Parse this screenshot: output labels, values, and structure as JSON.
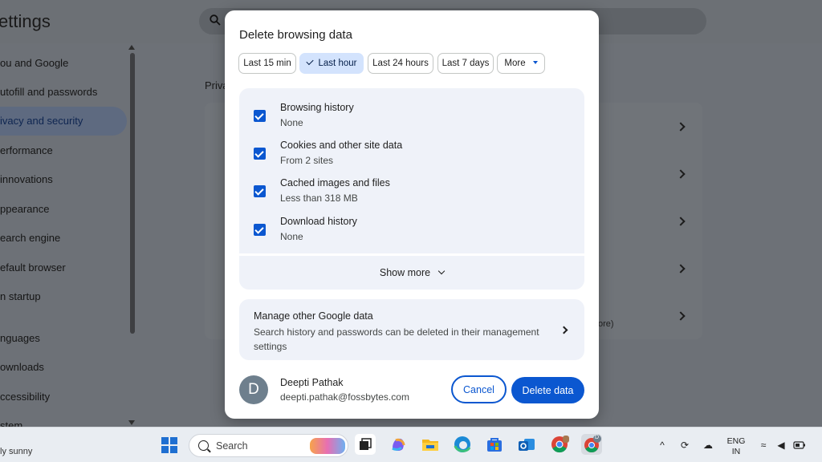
{
  "background": {
    "title": "ettings",
    "nav_items": [
      {
        "label": "ou and Google",
        "active": false
      },
      {
        "label": "utofill and passwords",
        "active": false
      },
      {
        "label": "ivacy and security",
        "active": true
      },
      {
        "label": "erformance",
        "active": false
      },
      {
        "label": " innovations",
        "active": false
      },
      {
        "label": "ppearance",
        "active": false
      },
      {
        "label": "earch engine",
        "active": false
      },
      {
        "label": "efault browser",
        "active": false
      },
      {
        "label": "n startup",
        "active": false
      },
      {
        "label": "nguages",
        "active": false
      },
      {
        "label": "ownloads",
        "active": false
      },
      {
        "label": "ccessibility",
        "active": false
      },
      {
        "label": "stem",
        "active": false
      }
    ],
    "section_label": "Priva",
    "card_fragment": "ore)"
  },
  "dialog": {
    "title": "Delete browsing data",
    "time_ranges": [
      {
        "label": "Last 15 min",
        "selected": false
      },
      {
        "label": "Last hour",
        "selected": true
      },
      {
        "label": "Last 24 hours",
        "selected": false
      },
      {
        "label": "Last 7 days",
        "selected": false
      },
      {
        "label": "More",
        "selected": false
      }
    ],
    "items": [
      {
        "title": "Browsing history",
        "subtitle": "None",
        "checked": true
      },
      {
        "title": "Cookies and other site data",
        "subtitle": "From 2 sites",
        "checked": true
      },
      {
        "title": "Cached images and files",
        "subtitle": "Less than 318 MB",
        "checked": true
      },
      {
        "title": "Download history",
        "subtitle": "None",
        "checked": true
      }
    ],
    "show_more": "Show more",
    "manage": {
      "title": "Manage other Google data",
      "subtitle": "Search history and passwords can be deleted in their management settings"
    },
    "account": {
      "initial": "D",
      "name": "Deepti Pathak",
      "email": "deepti.pathak@fossbytes.com"
    },
    "cancel_label": "Cancel",
    "delete_label": "Delete data",
    "accent_color": "#0b57d0"
  },
  "taskbar": {
    "weather": "ly sunny",
    "search_placeholder": "Search",
    "language_top": "ENG",
    "language_bottom": "IN",
    "chrome_profile_initial": "D"
  }
}
